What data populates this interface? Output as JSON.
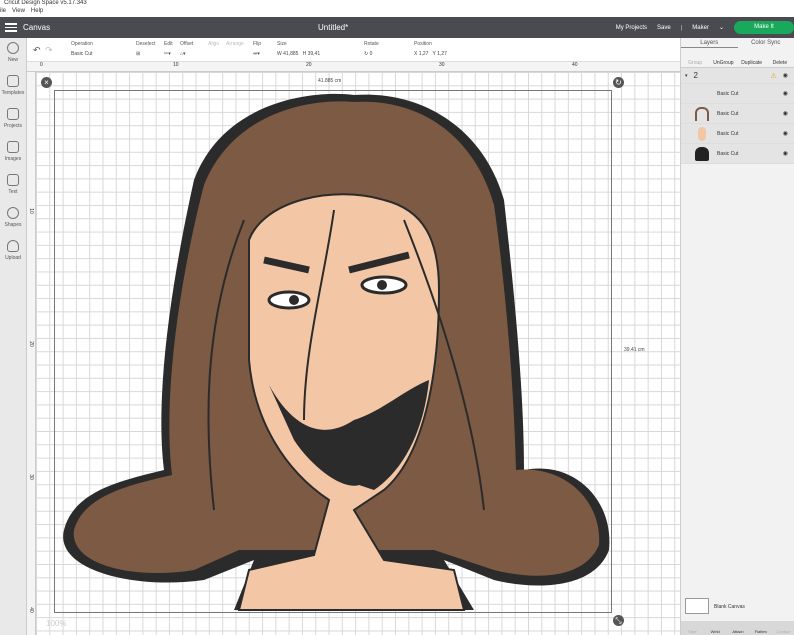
{
  "window": {
    "title": "Cricut Design Space v5.17.343"
  },
  "menu": [
    "ile",
    "View",
    "Help"
  ],
  "header": {
    "section": "Canvas",
    "title": "Untitled*",
    "my_projects": "My Projects",
    "save": "Save",
    "machine": "Maker",
    "make_it": "Make It"
  },
  "toolbar": {
    "operation_label": "Operation",
    "operation_value": "Basic Cut",
    "deselect": "Deselect",
    "edit": "Edit",
    "offset": "Offset",
    "align": "Align",
    "arrange": "Arrange",
    "flip": "Flip",
    "size": "Size",
    "w_label": "W",
    "w": "41,885",
    "h_label": "H",
    "h": "39,41",
    "rotate": "Rotate",
    "rotate_value": "0",
    "position": "Position",
    "x_label": "X",
    "x": "1,27",
    "y_label": "Y",
    "y": "1,27"
  },
  "sidebar": [
    "New",
    "Templates",
    "Projects",
    "Images",
    "Text",
    "Shapes",
    "Upload"
  ],
  "ruler_h": [
    "0",
    "10",
    "20",
    "30",
    "40"
  ],
  "ruler_v": [
    "10",
    "20",
    "30",
    "40"
  ],
  "canvas": {
    "width_dim": "41.885 cm",
    "height_dim": "39.41 cm",
    "zoom": "100%"
  },
  "panel": {
    "tabs": [
      "Layers",
      "Color Sync"
    ],
    "actions": [
      "Group",
      "UnGroup",
      "Duplicate",
      "Delete"
    ],
    "group_name": "2",
    "layers": [
      "Basic Cut",
      "Basic Cut",
      "Basic Cut",
      "Basic Cut"
    ],
    "blank_canvas": "Blank Canvas",
    "bottom": [
      "Slice",
      "Weld",
      "Attach",
      "Flatten",
      "Contour"
    ]
  },
  "colors": {
    "header": "#4a4b50",
    "make_it": "#18a95c",
    "hair": "#7d5a44",
    "skin": "#f3c7a6",
    "outline": "#2b2b2b"
  }
}
